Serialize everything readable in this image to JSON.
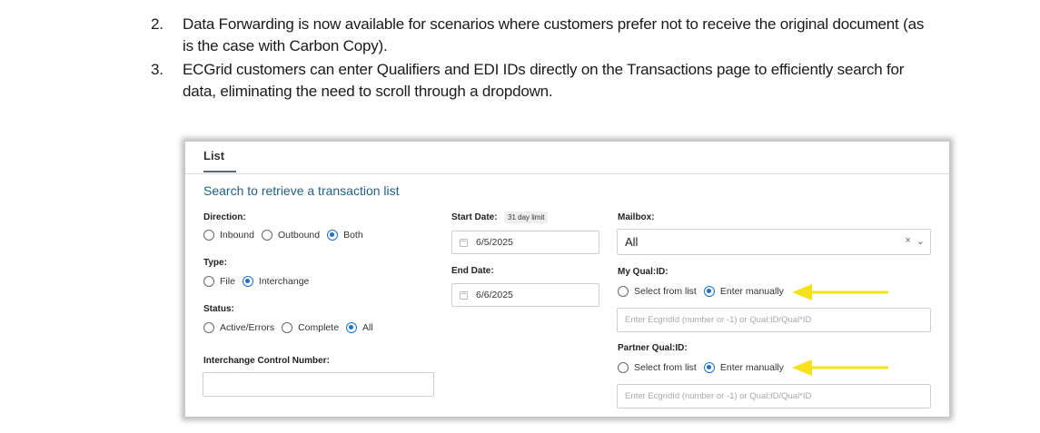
{
  "notes": [
    {
      "num": "2.",
      "text": "Data Forwarding is now available for scenarios where customers prefer not to receive the original document (as is the case with Carbon Copy)."
    },
    {
      "num": "3.",
      "text": "ECGrid customers can enter Qualifiers and EDI IDs directly on the Transactions page to efficiently search for data, eliminating the need to scroll through a dropdown."
    }
  ],
  "panel": {
    "tab": "List",
    "search_title": "Search to retrieve a transaction list",
    "direction": {
      "label": "Direction:",
      "options": [
        "Inbound",
        "Outbound",
        "Both"
      ],
      "selected": "Both"
    },
    "type": {
      "label": "Type:",
      "options": [
        "File",
        "Interchange"
      ],
      "selected": "Interchange"
    },
    "status": {
      "label": "Status:",
      "options": [
        "Active/Errors",
        "Complete",
        "All"
      ],
      "selected": "All"
    },
    "icn": {
      "label": "Interchange Control Number:",
      "value": ""
    },
    "start_date": {
      "label": "Start Date:",
      "badge": "31 day limit",
      "value": "6/5/2025"
    },
    "end_date": {
      "label": "End Date:",
      "value": "6/6/2025"
    },
    "mailbox": {
      "label": "Mailbox:",
      "value": "All",
      "clear_icon": "×",
      "chevron_icon": "⌄"
    },
    "my_qual": {
      "label": "My Qual:ID:",
      "options": [
        "Select from list",
        "Enter manually"
      ],
      "selected": "Enter manually",
      "placeholder": "Enter EcgridId (number or -1) or Qual:ID/Qual*ID"
    },
    "partner_qual": {
      "label": "Partner Qual:ID:",
      "options": [
        "Select from list",
        "Enter manually"
      ],
      "selected": "Enter manually",
      "placeholder": "Enter EcgridId (number or -1) or Qual:ID/Qual*ID"
    }
  },
  "colors": {
    "accent": "#1e6fc9",
    "title_blue": "#1f5f8b",
    "arrow_yellow": "#f7e11a"
  }
}
